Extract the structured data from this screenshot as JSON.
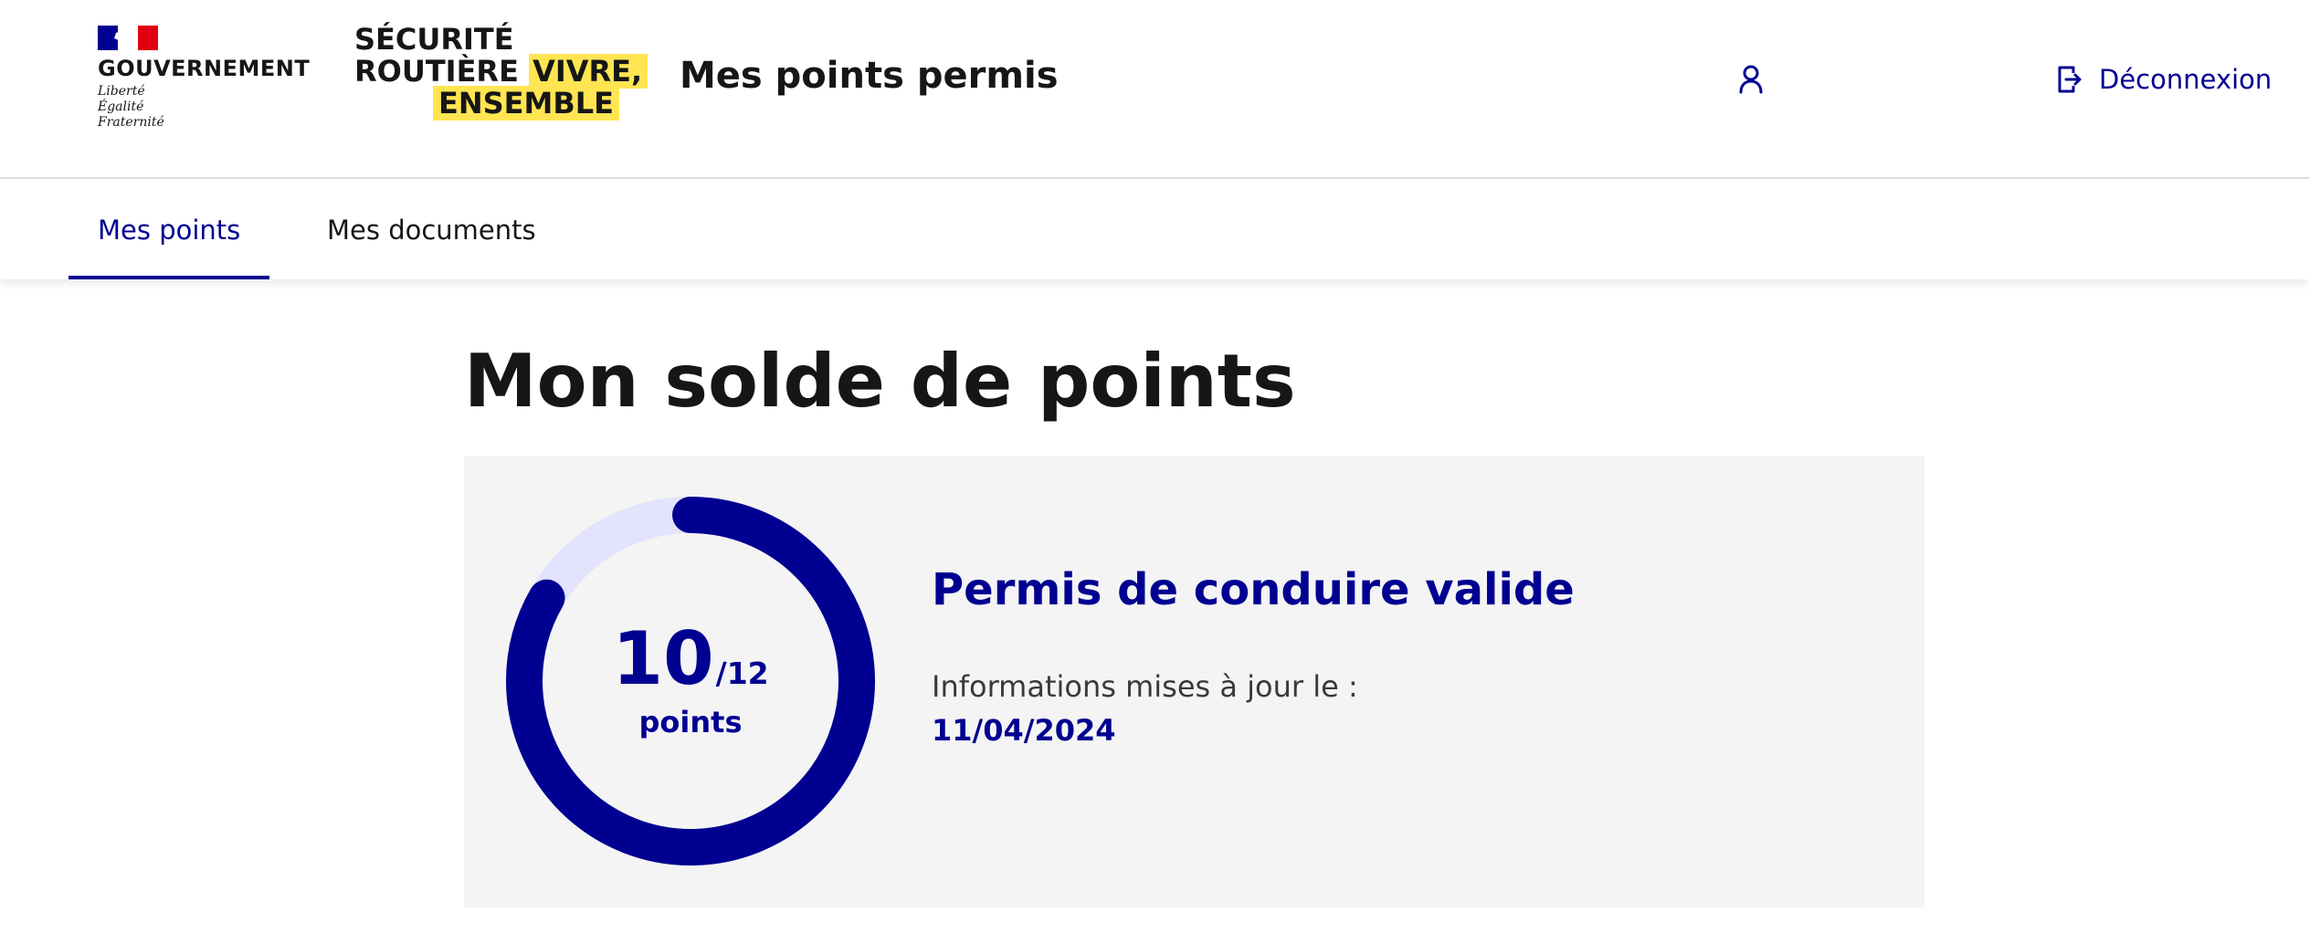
{
  "header": {
    "government": {
      "name": "GOUVERNEMENT",
      "motto": [
        "Liberté",
        "Égalité",
        "Fraternité"
      ]
    },
    "brand": {
      "line1": "SÉCURITÉ",
      "line2_plain": "ROUTIÈRE",
      "line2_highlight": "VIVRE,",
      "line3_highlight": "ENSEMBLE"
    },
    "service_title": "Mes points permis",
    "account_icon": "user-icon",
    "logout": {
      "label": "Déconnexion",
      "icon": "logout-icon"
    }
  },
  "nav": {
    "items": [
      {
        "label": "Mes points",
        "active": true
      },
      {
        "label": "Mes documents",
        "active": false
      }
    ]
  },
  "main": {
    "title": "Mon solde de points",
    "card": {
      "points": "10",
      "max": "/12",
      "unit": "points",
      "gauge_fraction": 0.8333,
      "status": "Permis de conduire valide",
      "update_label": "Informations mises à jour le :",
      "update_date": "11/04/2024"
    }
  },
  "colors": {
    "primary": "#000091",
    "gauge_track": "#e3e3fd",
    "brand_highlight": "#ffe552",
    "card_background": "#f4f4f4",
    "flag_blue": "#000091",
    "flag_red": "#e1000f"
  }
}
